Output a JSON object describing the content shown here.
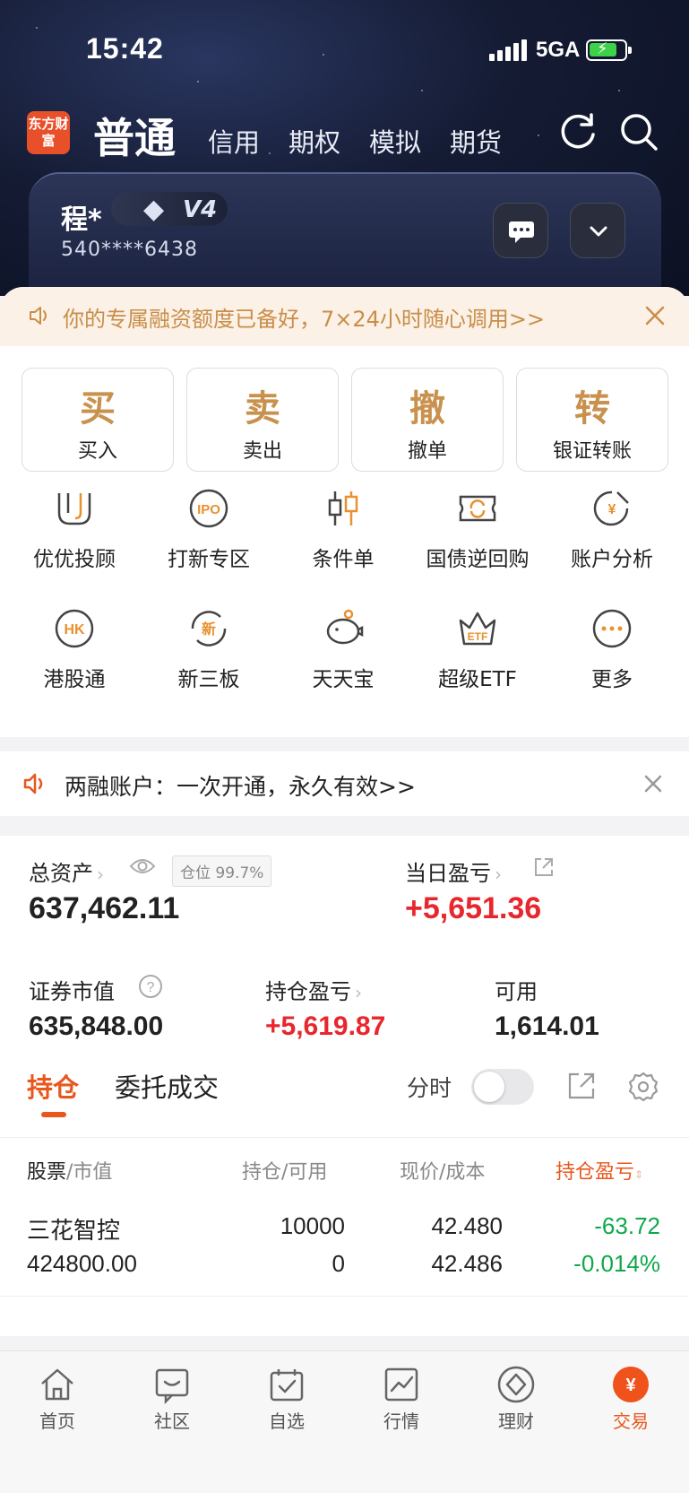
{
  "status_bar": {
    "time": "15:42",
    "network": "5GA"
  },
  "top_nav": {
    "logo_text": "东方财富",
    "tabs": [
      {
        "label": "普通",
        "active": true
      },
      {
        "label": "信用"
      },
      {
        "label": "期权"
      },
      {
        "label": "模拟"
      },
      {
        "label": "期货"
      }
    ]
  },
  "account": {
    "name": "程*",
    "level": "V4",
    "number": "540****6438"
  },
  "notice_credit": {
    "text": "你的专属融资额度已备好，7×24小时随心调用>>"
  },
  "trade_buttons": [
    {
      "big": "买",
      "label": "买入"
    },
    {
      "big": "卖",
      "label": "卖出"
    },
    {
      "big": "撤",
      "label": "撤单"
    },
    {
      "big": "转",
      "label": "银证转账"
    }
  ],
  "services_row1": [
    {
      "label": "优优投顾",
      "icon": "uu-advisor-icon"
    },
    {
      "label": "打新专区",
      "icon": "ipo-icon"
    },
    {
      "label": "条件单",
      "icon": "candlestick-icon"
    },
    {
      "label": "国债逆回购",
      "icon": "bond-repo-icon"
    },
    {
      "label": "账户分析",
      "icon": "account-analysis-icon"
    }
  ],
  "services_row2": [
    {
      "label": "港股通",
      "icon": "hk-icon"
    },
    {
      "label": "新三板",
      "icon": "new-third-board-icon"
    },
    {
      "label": "天天宝",
      "icon": "piggy-bank-icon"
    },
    {
      "label": "超级ETF",
      "icon": "etf-crown-icon"
    },
    {
      "label": "更多",
      "icon": "more-icon"
    }
  ],
  "notice_margin": {
    "text": "两融账户：一次开通，永久有效>>"
  },
  "assets": {
    "total_label": "总资产",
    "position_tag": "仓位 99.7%",
    "total_value": "637,462.11",
    "daily_pl_label": "当日盈亏",
    "daily_pl_value": "+5,651.36",
    "market_value_label": "证券市值",
    "market_value": "635,848.00",
    "holding_pl_label": "持仓盈亏",
    "holding_pl_value": "+5,619.87",
    "available_label": "可用",
    "available_value": "1,614.01"
  },
  "holdings": {
    "tab_active": "持仓",
    "tab_other": "委托成交",
    "toggle_label": "分时",
    "headers": {
      "stock": "股票",
      "stock2": "/市值",
      "qty": "持仓",
      "qty2": "/可用",
      "price": "现价",
      "price2": "/成本",
      "pl": "持仓盈亏"
    },
    "rows": [
      {
        "name": "三花智控",
        "market_value": "424800.00",
        "qty": "10000",
        "available": "0",
        "price": "42.480",
        "cost": "42.486",
        "pl": "-63.72",
        "pl_pct": "-0.014%"
      }
    ]
  },
  "tab_bar": [
    {
      "label": "首页",
      "icon": "home-icon"
    },
    {
      "label": "社区",
      "icon": "community-icon"
    },
    {
      "label": "自选",
      "icon": "watchlist-icon"
    },
    {
      "label": "行情",
      "icon": "market-icon"
    },
    {
      "label": "理财",
      "icon": "wealth-icon"
    },
    {
      "label": "交易",
      "icon": "trade-icon",
      "active": true
    }
  ],
  "colors": {
    "accent": "#e8581e",
    "gold": "#c9914e",
    "up": "#e8262d",
    "down": "#0fa84a"
  }
}
